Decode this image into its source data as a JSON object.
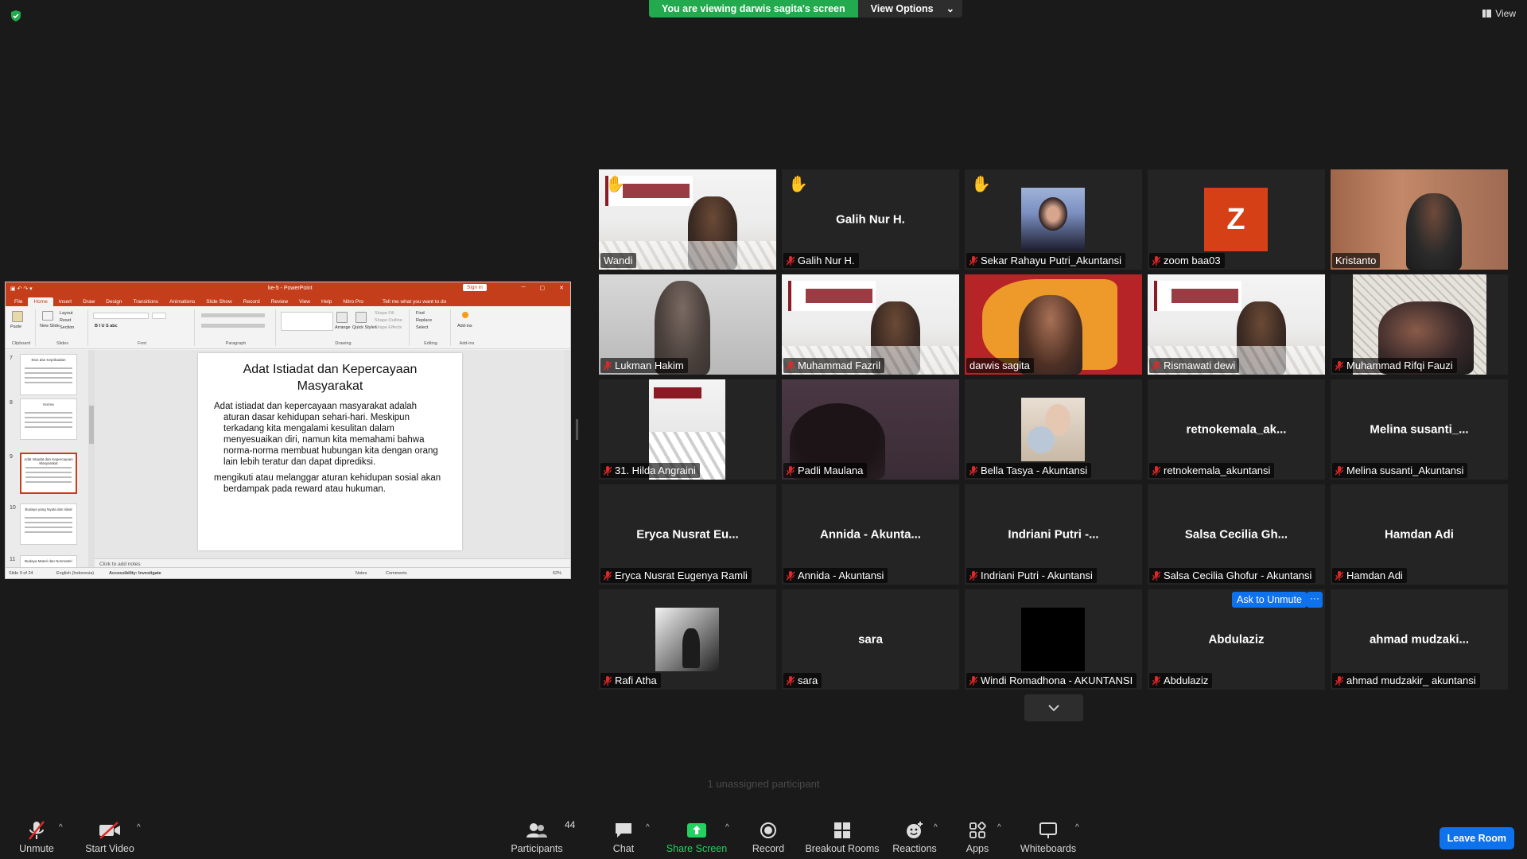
{
  "banner": {
    "viewing": "You are viewing darwis sagita's screen",
    "options": "View Options"
  },
  "view_button": "View",
  "ppt": {
    "window_title": "ke-5  -  PowerPoint",
    "sign_in": "Sign in",
    "tabs": [
      "File",
      "Home",
      "Insert",
      "Draw",
      "Design",
      "Transitions",
      "Animations",
      "Slide Show",
      "Record",
      "Review",
      "View",
      "Help",
      "Nitro Pro"
    ],
    "tell_me": "Tell me what you want to do",
    "ribbon": {
      "paste": "Paste",
      "new_slide": "New Slide",
      "layout": "Layout",
      "reset": "Reset",
      "section": "Section",
      "arrange": "Arrange",
      "quick_styles": "Quick Styles",
      "shape_fill": "Shape Fill",
      "shape_outline": "Shape Outline",
      "shape_effects": "Shape Effects",
      "find": "Find",
      "replace": "Replace",
      "select": "Select",
      "add_ins": "Add-ins",
      "groups": [
        "Clipboard",
        "Slides",
        "Font",
        "Paragraph",
        "Drawing",
        "Editing",
        "Add-ins"
      ]
    },
    "thumbnails": [
      {
        "num": "7",
        "title": "Etos dan Kepribadian"
      },
      {
        "num": "8",
        "title": "Norma"
      },
      {
        "num": "9",
        "title": "Adat Istiadat dan Kepercayaan Masyarakat"
      },
      {
        "num": "10",
        "title": "Budaya yang Nyata dan Ideal"
      },
      {
        "num": "11",
        "title": "Budaya Materi dan Nonmateri"
      }
    ],
    "slide": {
      "title": "Adat Istiadat dan Kepercayaan Masyarakat",
      "para1": "Adat istiadat dan kepercayaan masyarakat adalah aturan dasar kehidupan sehari-hari. Meskipun terkadang kita mengalami kesulitan dalam menyesuaikan diri, namun kita memahami bahwa norma-norma membuat hubungan kita dengan orang lain lebih teratur dan dapat diprediksi.",
      "para2": "mengikuti atau melanggar aturan kehidupan sosial akan berdampak pada reward atau hukuman."
    },
    "notes": "Click to add notes",
    "status": {
      "slide": "Slide 9 of 24",
      "language": "English (Indonesia)",
      "accessibility": "Accessibility: Investigate",
      "notes": "Notes",
      "comments": "Comments",
      "zoom": "62%"
    }
  },
  "participants": [
    {
      "name": "Wandi",
      "center": "",
      "hand": true,
      "kind": "video-slides"
    },
    {
      "name": "Galih Nur H.",
      "center": "Galih Nur H.",
      "hand": true,
      "kind": "name"
    },
    {
      "name": "Sekar Rahayu Putri_Akuntansi",
      "center": "",
      "hand": true,
      "kind": "photo"
    },
    {
      "name": "zoom baa03",
      "center": "Z",
      "hand": false,
      "kind": "letter"
    },
    {
      "name": "Kristanto",
      "center": "",
      "hand": false,
      "kind": "video-wood"
    },
    {
      "name": "Lukman Hakim",
      "center": "",
      "hand": false,
      "kind": "video-grey"
    },
    {
      "name": "Muhammad Fazril",
      "center": "",
      "hand": false,
      "kind": "video-slides"
    },
    {
      "name": "darwis sagita",
      "center": "",
      "hand": false,
      "kind": "video-orange"
    },
    {
      "name": "Rismawati dewi",
      "center": "",
      "hand": false,
      "kind": "video-slides"
    },
    {
      "name": "Muhammad Rifqi Fauzi",
      "center": "",
      "hand": false,
      "kind": "video-lattice"
    },
    {
      "name": "31. Hilda Angraini",
      "center": "",
      "hand": false,
      "kind": "video-slides-small"
    },
    {
      "name": "Padli Maulana",
      "center": "",
      "hand": false,
      "kind": "video-dark"
    },
    {
      "name": "Bella Tasya - Akuntansi",
      "center": "",
      "hand": false,
      "kind": "photo2"
    },
    {
      "name": "retnokemala_akuntansi",
      "center": "retnokemala_ak...",
      "hand": false,
      "kind": "name"
    },
    {
      "name": "Melina susanti_Akuntansi",
      "center": "Melina  susanti_...",
      "hand": false,
      "kind": "name"
    },
    {
      "name": "Eryca Nusrat Eugenya Ramli",
      "center": "Eryca Nusrat Eu...",
      "hand": false,
      "kind": "name"
    },
    {
      "name": "Annida - Akuntansi",
      "center": "Annida - Akunta...",
      "hand": false,
      "kind": "name"
    },
    {
      "name": "Indriani Putri - Akuntansi",
      "center": "Indriani Putri -...",
      "hand": false,
      "kind": "name"
    },
    {
      "name": "Salsa Cecilia Ghofur - Akuntansi",
      "center": "Salsa Cecilia Gh...",
      "hand": false,
      "kind": "name"
    },
    {
      "name": "Hamdan Adi",
      "center": "Hamdan Adi",
      "hand": false,
      "kind": "name"
    },
    {
      "name": "Rafi Atha",
      "center": "",
      "hand": false,
      "kind": "photo-bw"
    },
    {
      "name": "sara",
      "center": "sara",
      "hand": false,
      "kind": "name"
    },
    {
      "name": "Windi Romadhona - AKUNTANSI",
      "center": "",
      "hand": false,
      "kind": "black"
    },
    {
      "name": "Abdulaziz",
      "center": "Abdulaziz",
      "hand": false,
      "kind": "name"
    },
    {
      "name": "ahmad mudzakir_ akuntansi",
      "center": "ahmad  mudzaki...",
      "hand": false,
      "kind": "name"
    }
  ],
  "ask_to_unmute": "Ask to Unmute",
  "ask_more": "···",
  "unassigned": "1 unassigned participant",
  "toolbar": {
    "unmute": "Unmute",
    "start_video": "Start Video",
    "participants": "Participants",
    "participant_count": "44",
    "chat": "Chat",
    "share_screen": "Share Screen",
    "record": "Record",
    "breakout_rooms": "Breakout Rooms",
    "reactions": "Reactions",
    "apps": "Apps",
    "whiteboards": "Whiteboards",
    "leave_room": "Leave Room"
  },
  "colors": {
    "zoom_blue": "#0e72ed",
    "share_green": "#23d160",
    "banner_green": "#23a94e",
    "ppt_red": "#c43e1c",
    "active_speaker": "#d4d633",
    "avatar_z": "#d64016"
  }
}
